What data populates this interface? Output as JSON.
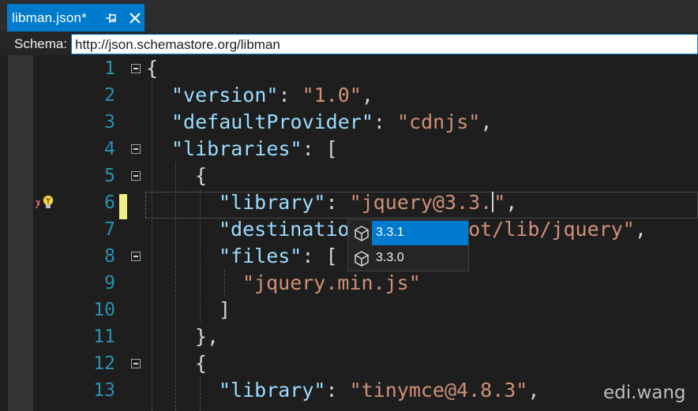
{
  "tab": {
    "title": "libman.json*"
  },
  "schema_bar": {
    "label": "Schema:",
    "url": "http://json.schemastore.org/libman"
  },
  "code_lines": [
    {
      "number": "1",
      "text": "{"
    },
    {
      "number": "2",
      "text": "\"version\": \"1.0\","
    },
    {
      "number": "3",
      "text": "\"defaultProvider\": \"cdnjs\","
    },
    {
      "number": "4",
      "text": "\"libraries\": ["
    },
    {
      "number": "5",
      "text": "{"
    },
    {
      "number": "6",
      "text": "\"library\": \"jquery@3.3.\","
    },
    {
      "number": "7",
      "text": "\"destination\": \"wwwroot/lib/jquery\","
    },
    {
      "number": "8",
      "text": "\"files\": ["
    },
    {
      "number": "9",
      "text": "\"jquery.min.js\""
    },
    {
      "number": "10",
      "text": "]"
    },
    {
      "number": "11",
      "text": "},"
    },
    {
      "number": "12",
      "text": "{"
    },
    {
      "number": "13",
      "text": "\"library\": \"tinymce@4.8.3\","
    }
  ],
  "autocomplete": {
    "items": [
      {
        "label": "3.3.1",
        "selected": true
      },
      {
        "label": "3.3.0",
        "selected": false
      }
    ]
  },
  "watermark": "edi.wang",
  "colors": {
    "accent": "#007acc",
    "line_number": "#2b91af",
    "json_key": "#9cdcfe",
    "json_string": "#ce9178",
    "editor_bg": "#1e1e1e"
  }
}
